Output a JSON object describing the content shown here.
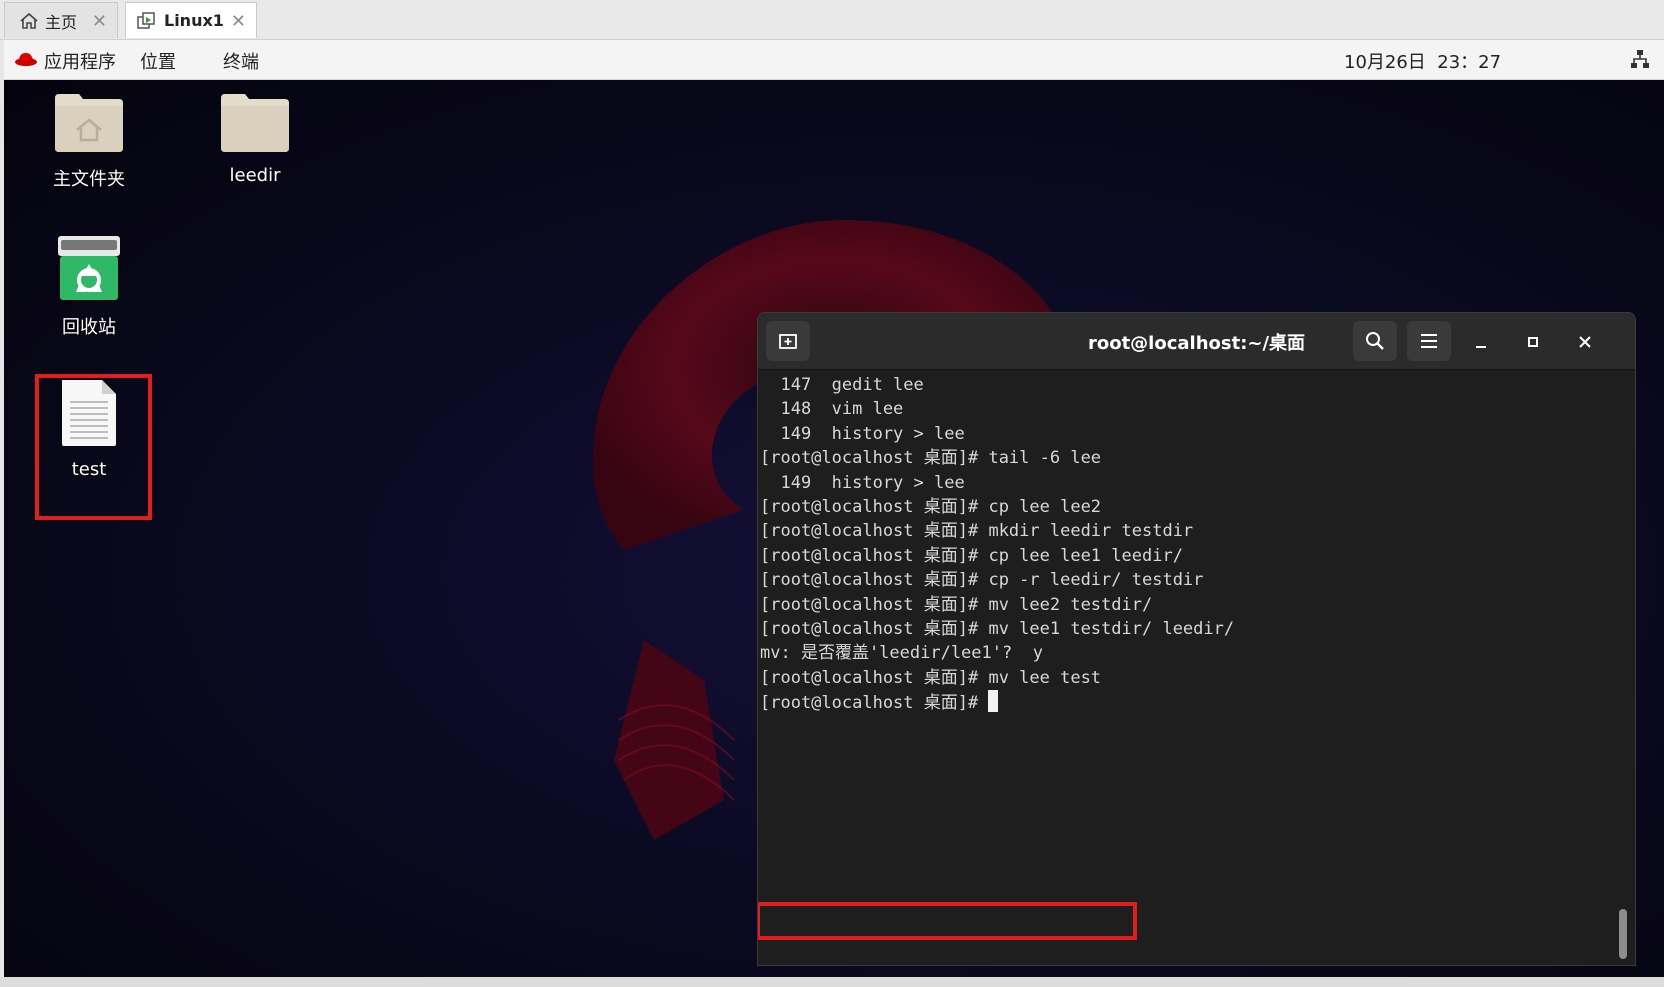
{
  "vm_tabs": [
    {
      "label": "主页"
    },
    {
      "label": "Linux1"
    }
  ],
  "top_panel": {
    "apps_menu": "应用程序",
    "places_menu": "位置",
    "terminal_menu": "终端",
    "clock": "10月26日  23：27"
  },
  "desktop": {
    "icons": [
      {
        "label": "主文件夹"
      },
      {
        "label": "leedir"
      },
      {
        "label": "回收站"
      },
      {
        "label": "test"
      }
    ]
  },
  "terminal": {
    "title": "root@localhost:~/桌面",
    "lines": [
      "  147  gedit lee",
      "  148  vim lee",
      "  149  history > lee",
      "",
      "",
      "",
      "",
      "",
      "[root@localhost 桌面]# tail -6 lee",
      "  149  history > lee",
      "",
      "",
      "",
      "",
      "",
      "[root@localhost 桌面]# cp lee lee2",
      "[root@localhost 桌面]# mkdir leedir testdir",
      "[root@localhost 桌面]# cp lee lee1 leedir/",
      "[root@localhost 桌面]# cp -r leedir/ testdir",
      "[root@localhost 桌面]# mv lee2 testdir/",
      "[root@localhost 桌面]# mv lee1 testdir/ leedir/",
      "mv: 是否覆盖'leedir/lee1'?  y",
      "[root@localhost 桌面]# mv lee test"
    ],
    "prompt": "[root@localhost 桌面]# "
  },
  "colors": {
    "highlight": "#e21d1d",
    "terminal_bg": "#1e1e1e",
    "terminal_header": "#2b2b2b",
    "trash_green": "#2fb866",
    "redhat_red": "#cc0000",
    "folder_beige": "#e4dccb"
  }
}
